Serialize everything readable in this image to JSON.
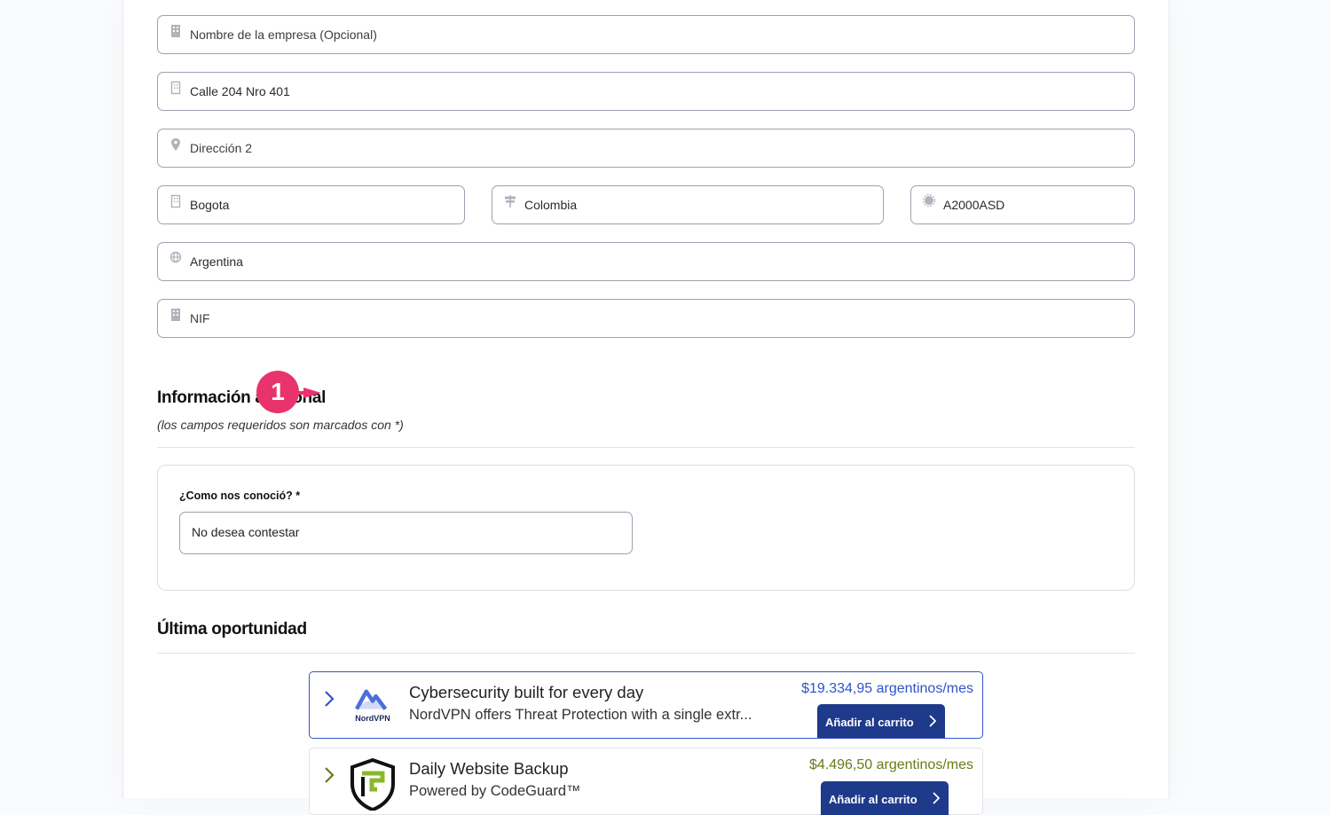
{
  "address": {
    "company": {
      "value": "Nombre de la empresa (Opcional)",
      "icon": "building-icon"
    },
    "address1": {
      "value": "Calle 204 Nro 401",
      "icon": "building-icon"
    },
    "address2": {
      "value": "Dirección 2",
      "icon": "map-pin-icon"
    },
    "city": {
      "value": "Bogota",
      "icon": "building-icon"
    },
    "state": {
      "value": "Colombia",
      "icon": "signpost-icon"
    },
    "postcode": {
      "value": "A2000ASD",
      "icon": "badge-icon"
    },
    "country": {
      "value": "Argentina",
      "icon": "globe-icon"
    },
    "tax_id": {
      "value": "NIF",
      "icon": "building-icon"
    }
  },
  "additional_info": {
    "title": "Información adicional",
    "note": "(los campos requeridos son marcados con *)",
    "step_badge": "1",
    "question_label": "¿Como nos conoció? *",
    "question_value": "No desea contestar"
  },
  "last_chance": {
    "title": "Última oportunidad",
    "offers": [
      {
        "logo_text": "NordVPN",
        "title": "Cybersecurity built for every day",
        "description": "NordVPN offers Threat Protection with a single extr...",
        "price": "$19.334,95 argentinos/mes",
        "cta": "Añadir al carrito",
        "accent": "#2f54c9"
      },
      {
        "title": "Daily Website Backup",
        "description": "Powered by CodeGuard™",
        "price": "$4.496,50 argentinos/mes",
        "cta": "Añadir al carrito",
        "accent": "#6a7a1a"
      }
    ]
  }
}
